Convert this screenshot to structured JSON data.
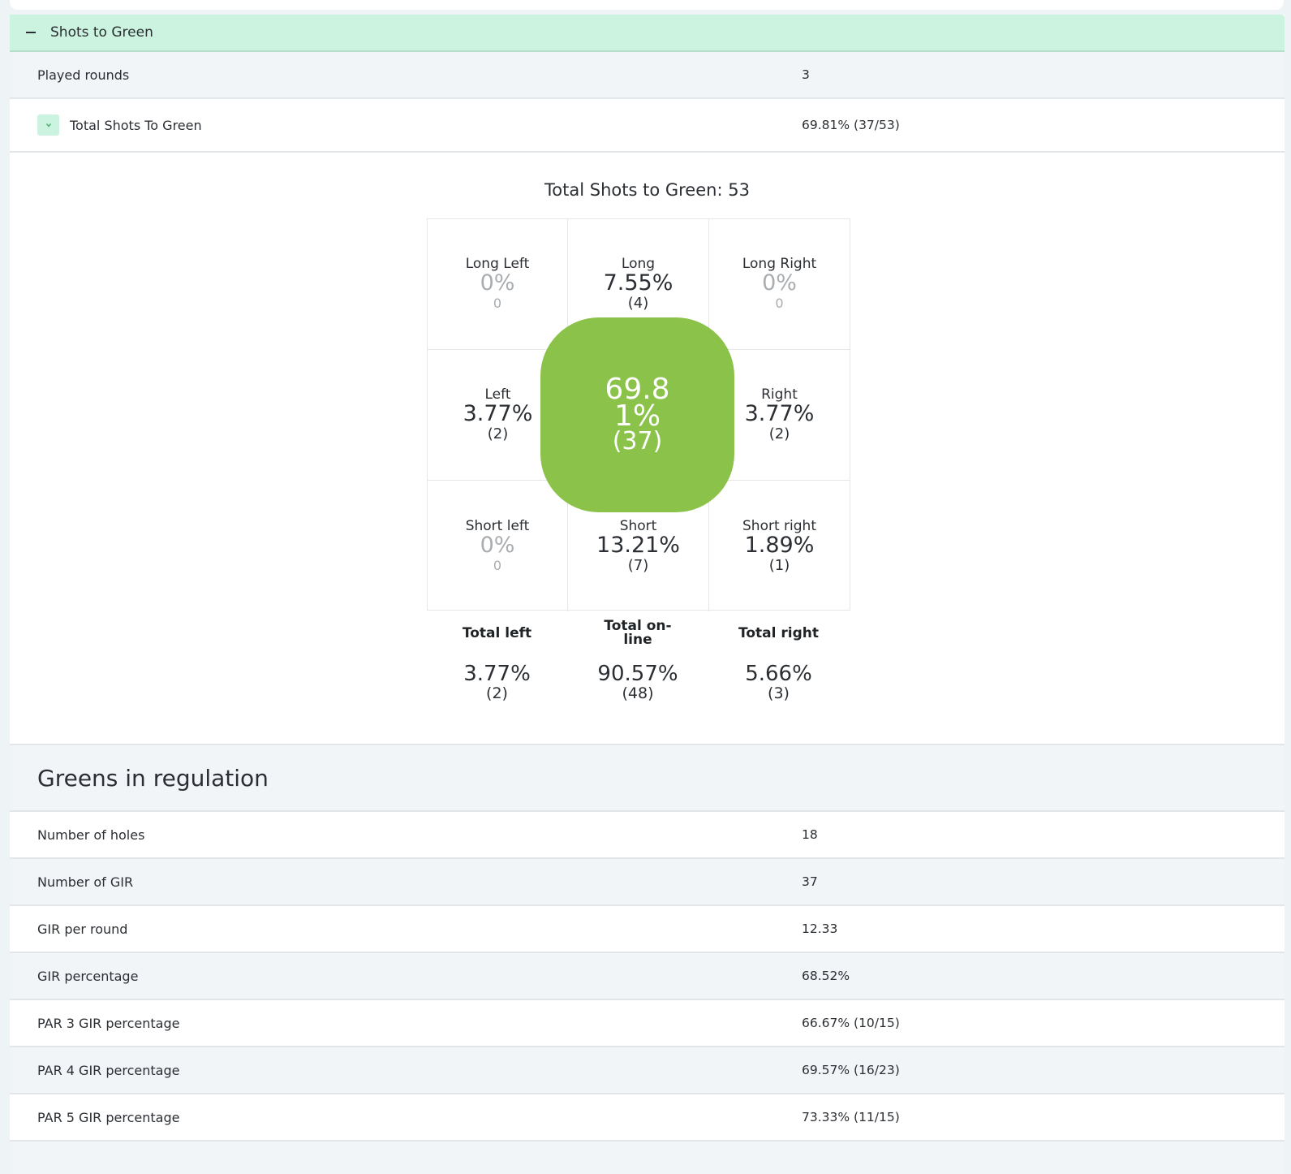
{
  "shots_to_green": {
    "section_title": "Shots to Green",
    "rows": [
      {
        "label": "Played rounds",
        "value": "3"
      },
      {
        "label": "Total Shots To Green",
        "value": "69.81% (37/53)"
      }
    ],
    "chart": {
      "title": "Total Shots to Green: 53",
      "cells": [
        {
          "name": "Long Left",
          "pct": "0%",
          "count": "0"
        },
        {
          "name": "Long",
          "pct": "7.55%",
          "count": "(4)"
        },
        {
          "name": "Long Right",
          "pct": "0%",
          "count": "0"
        },
        {
          "name": "Left",
          "pct": "3.77%",
          "count": "(2)"
        },
        {
          "name": "",
          "pct": "",
          "count": ""
        },
        {
          "name": "Right",
          "pct": "3.77%",
          "count": "(2)"
        },
        {
          "name": "Short left",
          "pct": "0%",
          "count": "0"
        },
        {
          "name": "Short",
          "pct": "13.21%",
          "count": "(7)"
        },
        {
          "name": "Short right",
          "pct": "1.89%",
          "count": "(1)"
        }
      ],
      "center": {
        "pct": "69.81%",
        "count": "(37)",
        "color": "#8bc24a"
      },
      "totals": [
        {
          "name": "Total left",
          "pct": "3.77%",
          "count": "(2)"
        },
        {
          "name": "Total on-line",
          "pct": "90.57%",
          "count": "(48)"
        },
        {
          "name": "Total right",
          "pct": "5.66%",
          "count": "(3)"
        }
      ]
    }
  },
  "greens_in_regulation": {
    "title": "Greens in regulation",
    "rows": [
      {
        "label": "Number of holes",
        "value": "18"
      },
      {
        "label": "Number of GIR",
        "value": "37"
      },
      {
        "label": "GIR per round",
        "value": "12.33"
      },
      {
        "label": "GIR percentage",
        "value": "68.52%"
      },
      {
        "label": "PAR 3 GIR percentage",
        "value": "66.67% (10/15)"
      },
      {
        "label": "PAR 4 GIR percentage",
        "value": "69.57% (16/23)"
      },
      {
        "label": "PAR 5 GIR percentage",
        "value": "73.33% (11/15)"
      }
    ]
  },
  "colors": {
    "header_green": "#cbf3df",
    "accent_green": "#8bc24a",
    "alt_row": "#f1f5f8"
  }
}
